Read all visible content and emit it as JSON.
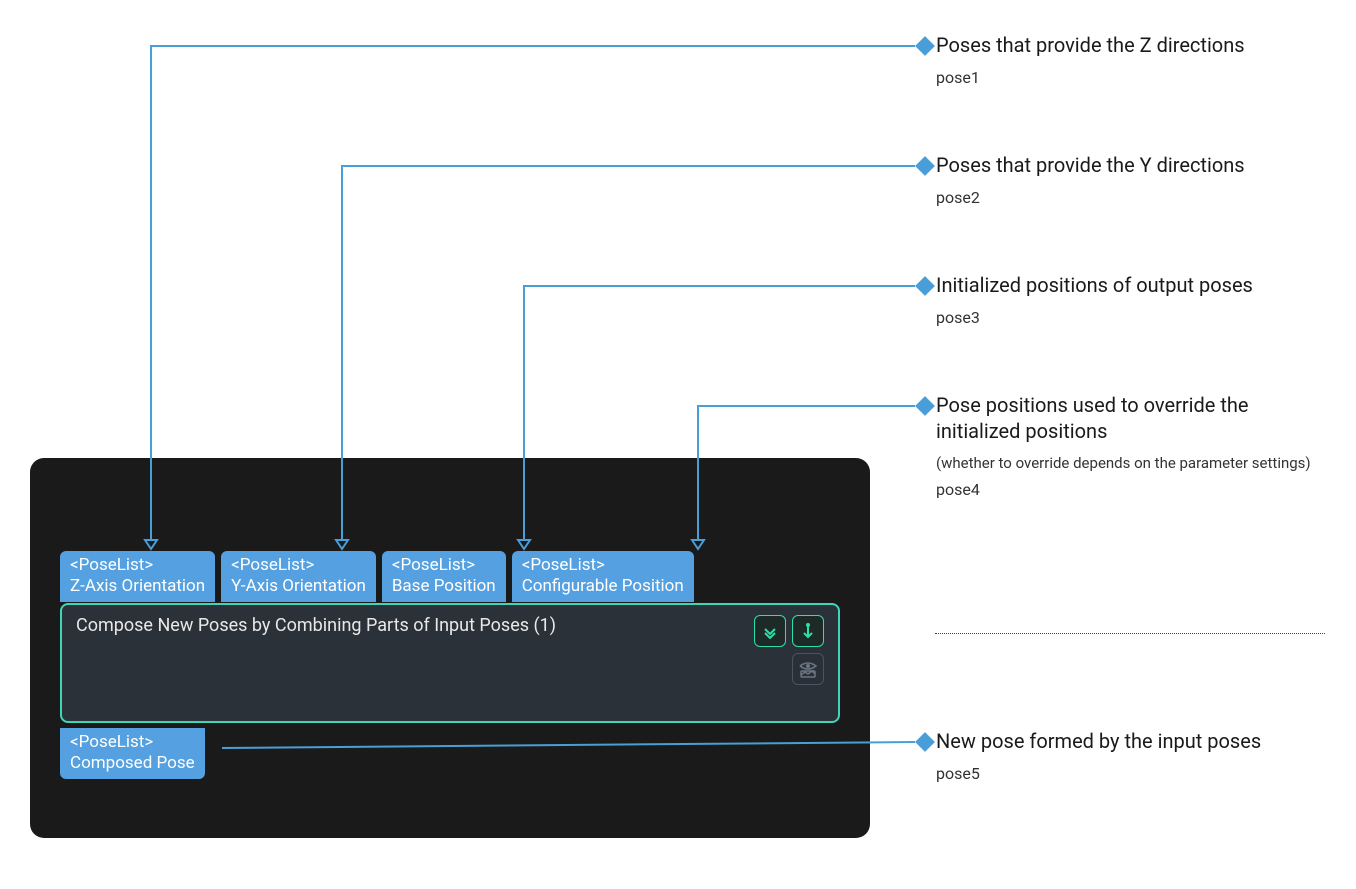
{
  "node": {
    "title": "Compose New Poses by Combining Parts of Input Poses (1)",
    "inputs": [
      {
        "type": "<PoseList>",
        "label": "Z-Axis Orientation"
      },
      {
        "type": "<PoseList>",
        "label": "Y-Axis Orientation"
      },
      {
        "type": "<PoseList>",
        "label": "Base Position"
      },
      {
        "type": "<PoseList>",
        "label": "Configurable Position"
      }
    ],
    "output": {
      "type": "<PoseList>",
      "label": "Composed Pose"
    }
  },
  "annotations": [
    {
      "title": "Poses that provide the Z directions",
      "sub": "pose1"
    },
    {
      "title": "Poses that provide the Y directions",
      "sub": "pose2"
    },
    {
      "title": "Initialized positions of output poses",
      "sub": "pose3"
    },
    {
      "title": "Pose positions used to override the initialized positions",
      "note": "(whether to override depends on the parameter settings)",
      "sub": "pose4"
    },
    {
      "title": "New pose formed by the input poses",
      "sub": "pose5"
    }
  ],
  "icons": {
    "expand": "expand-down-icon",
    "run": "download-icon",
    "preview": "eye-image-icon"
  }
}
